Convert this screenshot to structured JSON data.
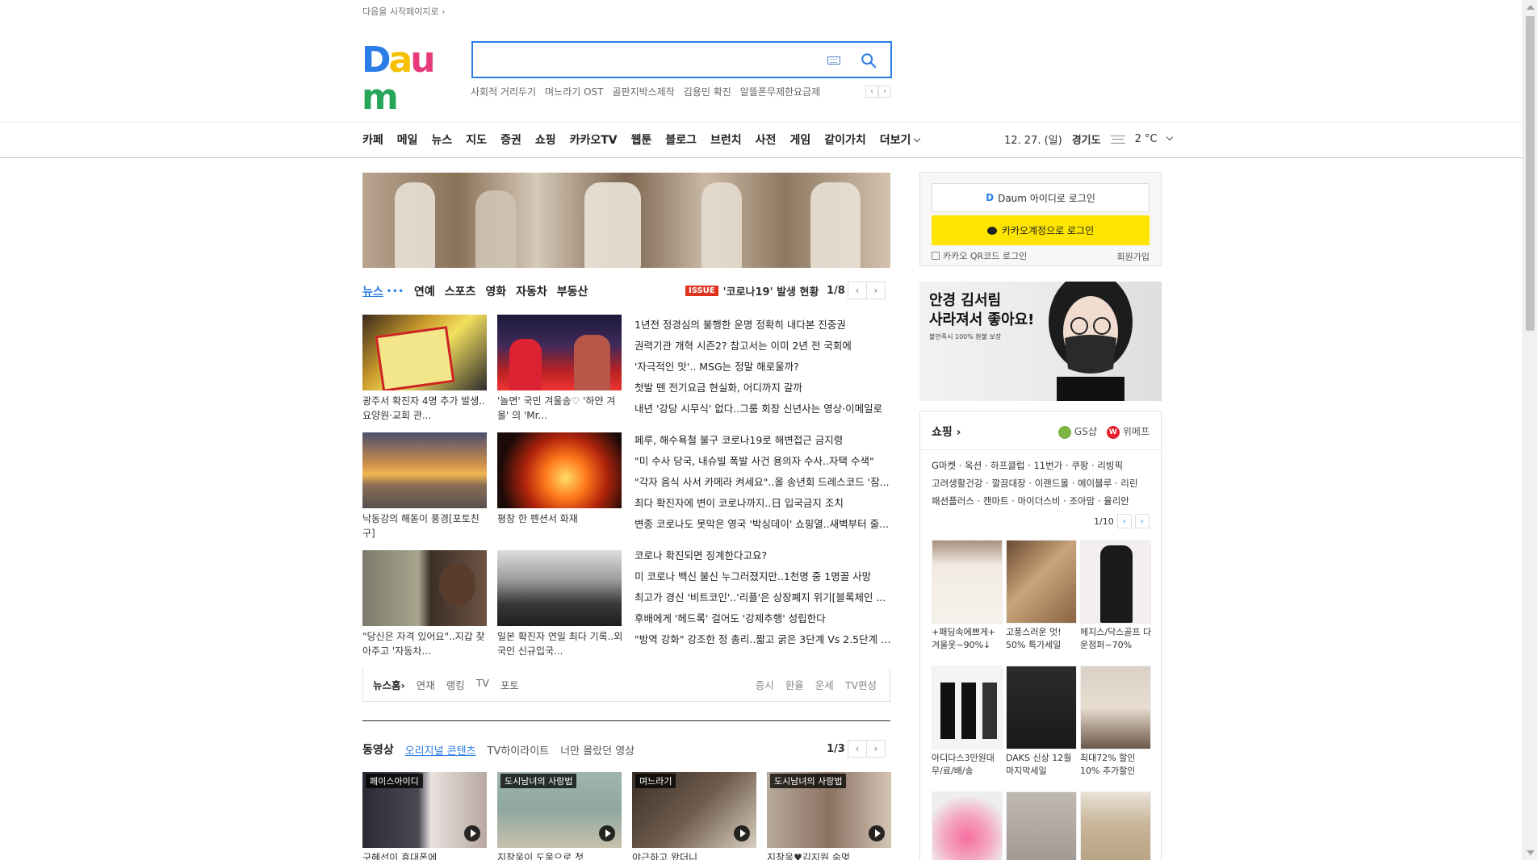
{
  "top_link": "다음을 시작페이지로 ›",
  "logo": {
    "letters": [
      "D",
      "a",
      "u",
      "m"
    ],
    "colors": [
      "#2a7ce6",
      "#f5c000",
      "#e63c7c",
      "#26a65b"
    ]
  },
  "search": {
    "value": "",
    "placeholder": ""
  },
  "trending": [
    "사회적 거리두기",
    "며느라기 OST",
    "골판지박스제작",
    "김용민 확진",
    "알뜰폰무제한요금제"
  ],
  "trend_nav": {
    "prev": "‹",
    "next": "›"
  },
  "gnb": [
    "카페",
    "메일",
    "뉴스",
    "지도",
    "증권",
    "쇼핑",
    "카카오TV",
    "웹툰",
    "블로그",
    "브런치",
    "사전",
    "게임",
    "같이가치",
    "더보기"
  ],
  "weather": {
    "date": "12. 27. (일)",
    "region": "경기도",
    "temp": "2 °C"
  },
  "news_tabs": [
    "뉴스",
    "연예",
    "스포츠",
    "영화",
    "자동차",
    "부동산"
  ],
  "news_tabs_dots": "•••",
  "issue": {
    "badge": "ISSUE",
    "text": "'코로나19' 발생 현황"
  },
  "news_pager": {
    "num": "1/8",
    "prev": "‹",
    "next": "›"
  },
  "news_thumbs": [
    {
      "caption": "광주서 확진자 4명 추가 발생..요양원·교회 관..."
    },
    {
      "caption": "'놀면' 국민 겨울송♡ '하얀 겨울' 의 'Mr..."
    },
    {
      "caption": "낙동강의 해돋이 풍경[포토친구]"
    },
    {
      "caption": "평창 한 펜션서 화재"
    },
    {
      "caption": "\"당신은 자격 있어요\"..지갑 찾아주고 '자동차..."
    },
    {
      "caption": "일본 확진자 연일 최다 기록..외국인 신규입국..."
    }
  ],
  "headlines": [
    [
      "1년전 정경심의 불행한 운명 정확히 내다본 진중권",
      "권력기관 개혁 시즌2? 참고서는 이미 2년 전 국회에",
      "'자극적인 맛'.. MSG는 정말 해로울까?",
      "첫발 뗀 전기요금 현실화, 어디까지 갈까",
      "내년 '강당 시무식' 없다..그룹 회장 신년사는 영상·이메일로"
    ],
    [
      "페루, 해수욕철 불구 코로나19로 해변접근 금지령",
      "\"미 수사 당국, 내슈빌 폭발 사건 용의자 수사..자택 수색\"",
      "\"각자 음식 사서 카메라 켜세요\"..올 송년회 드레스코드 '잠...",
      "최다 확진자에 변이 코로나까지..日 입국금지 조치",
      "변종 코로나도 못막은 영국 '박싱데이' 쇼핑열..새벽부터 줄..."
    ],
    [
      "코로나 확진되면 징계한다고요?",
      "미 코로나 백신 불신 누그러졌지만..1천명 중 1명꼴 사망",
      "최고가 경신 '비트코인'..'리플'은 상장폐지 위기[블록체인 ...",
      "후배에게 '헤드록' 걸어도 '강제추행' 성립한다",
      "\"방역 강화\" 강조한 정 총리..짧고 굵은 3단계 Vs 2.5단계 연..."
    ]
  ],
  "news_foot": {
    "left": [
      "뉴스홈›",
      "연재",
      "랭킹",
      "TV",
      "포토"
    ],
    "right": [
      "증시",
      "환율",
      "운세",
      "TV편성"
    ]
  },
  "video": {
    "title": "동영상",
    "tabs": [
      "오리지널 콘텐츠",
      "TV하이라이트",
      "너만 몰랐던 영상"
    ],
    "pager": "1/3"
  },
  "videos": [
    {
      "tag": "페이스아이디",
      "caption": "구혜선이 휴대폰에"
    },
    {
      "tag": "도시남녀의 사랑법",
      "caption": "지창욱이 도움으로 첫"
    },
    {
      "tag": "며느라기",
      "caption": "야근하고 왔더니"
    },
    {
      "tag": "도시남녀의 사랑법",
      "caption": "지창욱♥김지원 숨멎"
    }
  ],
  "login": {
    "daum": "Daum 아이디로 로그인",
    "daum_mark": "D",
    "kakao": "카카오계정으로 로그인",
    "qr": "카카오 QR코드 로그인",
    "join": "회원가입"
  },
  "ad": {
    "headline": "안경 김서림\n사라져서 좋아요!",
    "sub": "불만족시 100% 환불 보장"
  },
  "shop": {
    "title": "쇼핑 ›",
    "partners": [
      "GS샵",
      "위메프"
    ],
    "partner_mark_w": "W",
    "links": [
      "G마켓 · 옥션 · 하프클럽 · 11번가 · 쿠팡 · 리빙픽",
      "고려생활건강 · 깔끔대장 · 이랜드몰 · 에이블루 · 리린",
      "패션플러스 · 캔마트 · 마이더스비 · 조아맘 · 율리안"
    ],
    "pager": "1/10",
    "products": [
      {
        "caption": "+패딩속에쁘게+ 겨울옷~90%↓"
      },
      {
        "caption": "고풍스러운 멋! 50% 특가세일"
      },
      {
        "caption": "헤지스/닥스골프 다운점퍼~70%"
      },
      {
        "caption": "아디다스3만원대 무/료/배/송"
      },
      {
        "caption": "DAKS 신상 12월마지막세일"
      },
      {
        "caption": "최대72% 할인 10% 추가할인"
      },
      {
        "caption": ""
      },
      {
        "caption": ""
      },
      {
        "caption": ""
      }
    ]
  },
  "colors": {
    "accent": "#2a7ce6",
    "issue": "#e0331f",
    "kakao": "#fee500"
  }
}
